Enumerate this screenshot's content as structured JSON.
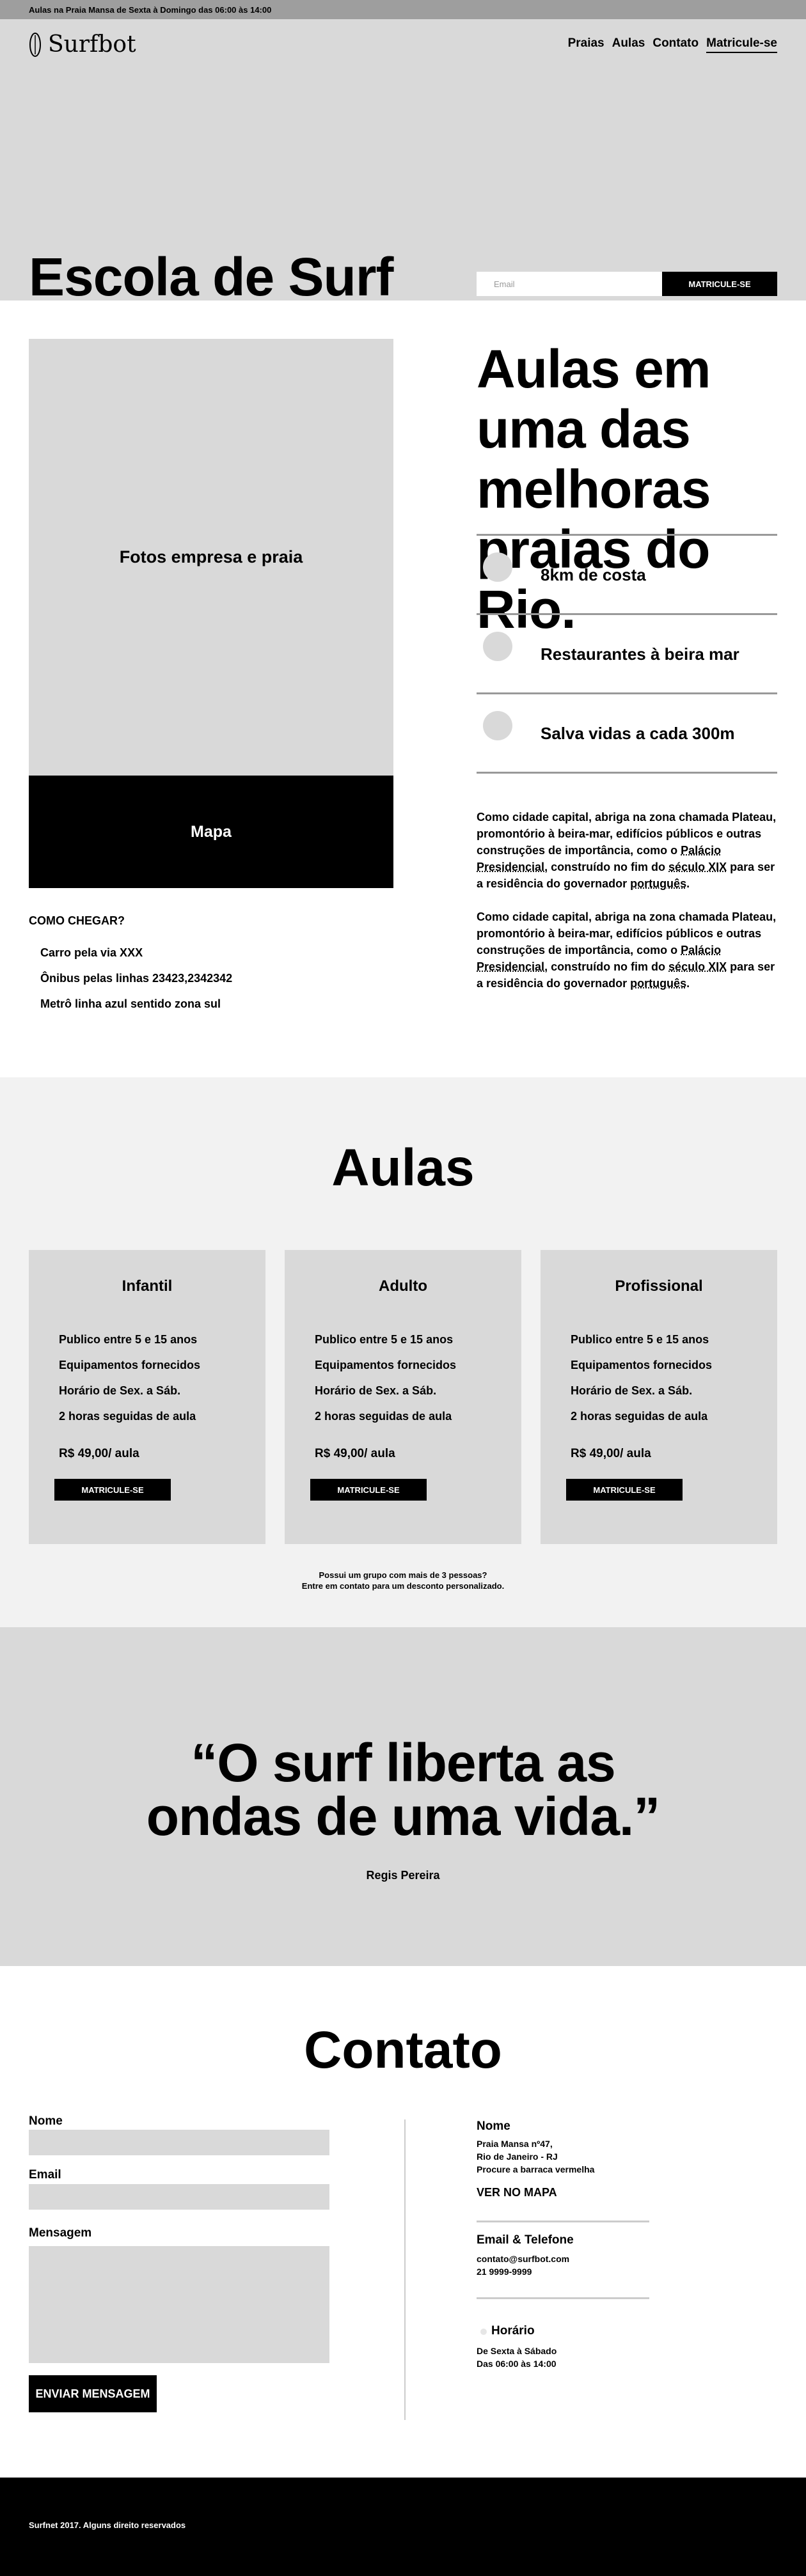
{
  "topbar": {
    "text": "Aulas na Praia Mansa de Sexta à Domingo das 06:00 às 14:00"
  },
  "nav": {
    "logo_text": "Surfbot",
    "items": [
      "Praias",
      "Aulas",
      "Contato",
      "Matricule-se"
    ]
  },
  "hero": {
    "title": "Escola de Surf",
    "email_placeholder": "Email",
    "button_label": "MATRICULE-SE"
  },
  "about": {
    "photo_label": "Fotos empresa e praia",
    "map_label": "Mapa",
    "how_title": "COMO CHEGAR?",
    "how_items": [
      "Carro pela via XXX",
      "Ônibus pelas linhas 23423,2342342",
      "Metrô linha azul sentido zona sul"
    ],
    "title": "Aulas em uma das melhoras praias do Rio.",
    "features": [
      "8km de costa",
      "Restaurantes à beira mar",
      "Salva vidas a cada 300m"
    ],
    "paragraph": {
      "a": "Como cidade capital, abriga na zona chamada Plateau, promontório à beira-mar, edifícios públicos e outras construções de importância, como o ",
      "link1": "Palácio Presidencial",
      "b": ", construído no fim do ",
      "link2": "século XIX",
      "c": " para ser a residência do governador ",
      "link3": "português",
      "d": "."
    }
  },
  "aulas": {
    "title": "Aulas",
    "cards": [
      {
        "title": "Infantil",
        "items": [
          "Publico entre 5 e 15 anos",
          "Equipamentos fornecidos",
          "Horário de Sex. a Sáb.",
          "2 horas seguidas de aula"
        ],
        "price": "R$ 49,00/ aula",
        "button": "MATRICULE-SE"
      },
      {
        "title": "Adulto",
        "items": [
          "Publico entre 5 e 15 anos",
          "Equipamentos fornecidos",
          "Horário de Sex. a Sáb.",
          "2 horas seguidas de aula"
        ],
        "price": "R$ 49,00/ aula",
        "button": "MATRICULE-SE"
      },
      {
        "title": "Profissional",
        "items": [
          "Publico entre 5 e 15 anos",
          "Equipamentos fornecidos",
          "Horário de Sex. a Sáb.",
          "2 horas seguidas de aula"
        ],
        "price": "R$ 49,00/ aula",
        "button": "MATRICULE-SE"
      }
    ],
    "note_line1": "Possui um grupo com mais de 3 pessoas?",
    "note_line2": "Entre em contato para um desconto personalizado."
  },
  "quote": {
    "line1": "“O surf liberta as",
    "line2": "ondas de uma vida.”",
    "author": "Regis Pereira"
  },
  "contato": {
    "title": "Contato",
    "form": {
      "name_label": "Nome",
      "email_label": "Email",
      "message_label": "Mensagem",
      "send_label": "ENVIAR MENSAGEM"
    },
    "info": {
      "address_title": "Nome",
      "address_lines": [
        "Praia Mansa nº47,",
        "Rio de Janeiro - RJ",
        "Procure a barraca vermelha"
      ],
      "map_link": "VER NO MAPA",
      "contact_title": "Email & Telefone",
      "contact_lines": [
        "contato@surfbot.com",
        "21 9999-9999"
      ],
      "hours_title": "Horário",
      "hours_lines": [
        "De Sexta à Sábado",
        "Das 06:00 às 14:00"
      ]
    }
  },
  "footer": {
    "text": "Surfnet 2017. Alguns direito reservados"
  }
}
